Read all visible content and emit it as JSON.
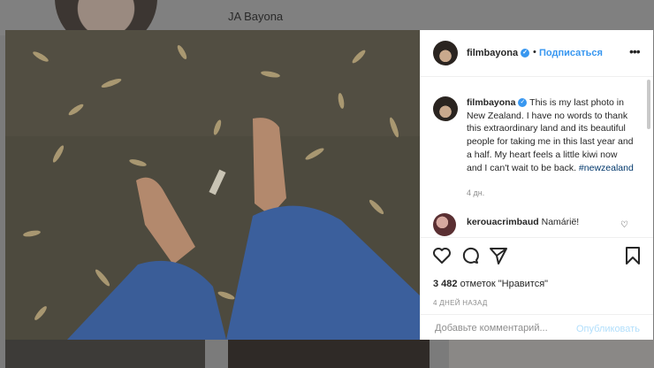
{
  "background": {
    "profile_name": "JA Bayona"
  },
  "post": {
    "username": "filmbayona",
    "dot": "•",
    "follow_label": "Подписаться",
    "more_icon": "more-horizontal-icon",
    "caption": {
      "username": "filmbayona",
      "text": "This is my last photo in New Zealand. I have no words to thank this extraordinary land and its beautiful people for taking me in this last year and a half. My heart feels a little kiwi now and I can't wait to be back.",
      "hashtag": "#newzealand",
      "time": "4 дн."
    },
    "comment": {
      "username": "kerouacrimbaud",
      "text": "Namárië!"
    },
    "likes": {
      "count": "3 482",
      "label": "отметок \"Нравится\""
    },
    "date": "4 ДНЕЙ НАЗАД",
    "add_comment": {
      "placeholder": "Добавьте комментарий...",
      "publish_label": "Опубликовать"
    },
    "accent_color": "#3897f0"
  }
}
